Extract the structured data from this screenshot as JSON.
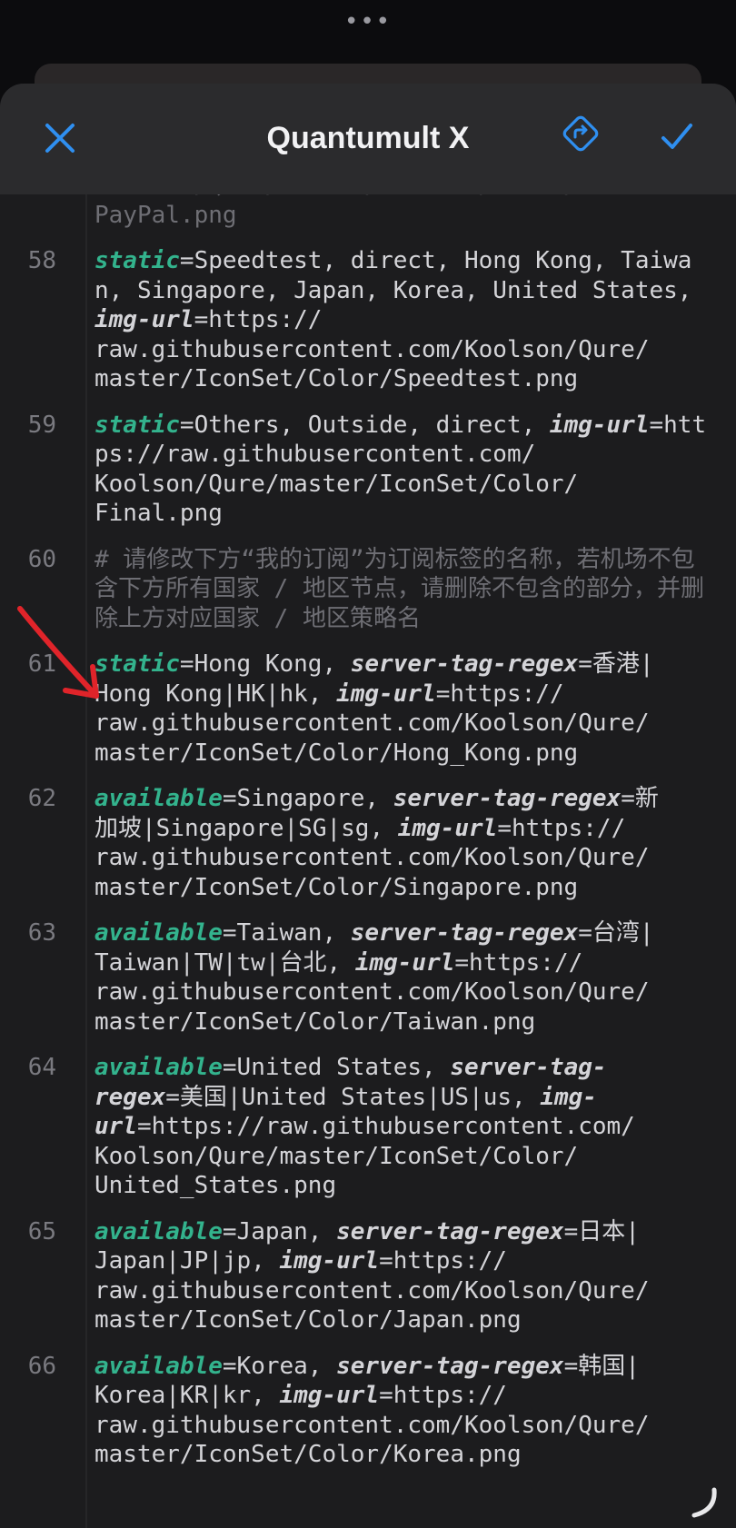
{
  "nav": {
    "title": "Quantumult X"
  },
  "lines": [
    {
      "num": "",
      "parts": [
        {
          "t": "Koolson/Qure/master/IconSet/Color/\nPayPal.png",
          "c": "dim"
        }
      ]
    },
    {
      "num": "58",
      "parts": [
        {
          "t": "static",
          "c": "kw"
        },
        {
          "t": "=Speedtest, direct, Hong Kong, Taiwan, Singapore, Japan, Korea, United States, "
        },
        {
          "t": "img-url",
          "c": "opt"
        },
        {
          "t": "=https://\nraw.githubusercontent.com/Koolson/Qure/\nmaster/IconSet/Color/Speedtest.png"
        }
      ]
    },
    {
      "num": "59",
      "parts": [
        {
          "t": "static",
          "c": "kw"
        },
        {
          "t": "=Others, Outside, direct, "
        },
        {
          "t": "img-url",
          "c": "opt"
        },
        {
          "t": "=https://raw.githubusercontent.com/\nKoolson/Qure/master/IconSet/Color/\nFinal.png"
        }
      ]
    },
    {
      "num": "60",
      "parts": [
        {
          "t": "# 请修改下方“我的订阅”为订阅标签的名称，若机场不包含下方所有国家 / 地区节点，请删除不包含的部分，并删除上方对应国家 / 地区策略名",
          "c": "comment"
        }
      ]
    },
    {
      "num": "61",
      "parts": [
        {
          "t": "static",
          "c": "kw"
        },
        {
          "t": "=Hong Kong, "
        },
        {
          "t": "server-tag-regex",
          "c": "opt"
        },
        {
          "t": "=香港|\nHong Kong|HK|hk, "
        },
        {
          "t": "img-url",
          "c": "opt"
        },
        {
          "t": "=https://\nraw.githubusercontent.com/Koolson/Qure/\nmaster/IconSet/Color/Hong_Kong.png"
        }
      ]
    },
    {
      "num": "62",
      "parts": [
        {
          "t": "available",
          "c": "kw"
        },
        {
          "t": "=Singapore, "
        },
        {
          "t": "server-tag-regex",
          "c": "opt"
        },
        {
          "t": "=新\n加坡|Singapore|SG|sg, "
        },
        {
          "t": "img-url",
          "c": "opt"
        },
        {
          "t": "=https://\nraw.githubusercontent.com/Koolson/Qure/\nmaster/IconSet/Color/Singapore.png"
        }
      ]
    },
    {
      "num": "63",
      "parts": [
        {
          "t": "available",
          "c": "kw"
        },
        {
          "t": "=Taiwan, "
        },
        {
          "t": "server-tag-regex",
          "c": "opt"
        },
        {
          "t": "=台湾|\nTaiwan|TW|tw|台北, "
        },
        {
          "t": "img-url",
          "c": "opt"
        },
        {
          "t": "=https://\nraw.githubusercontent.com/Koolson/Qure/\nmaster/IconSet/Color/Taiwan.png"
        }
      ]
    },
    {
      "num": "64",
      "parts": [
        {
          "t": "available",
          "c": "kw"
        },
        {
          "t": "=United States, "
        },
        {
          "t": "server-tag-\nregex",
          "c": "opt"
        },
        {
          "t": "=美国|United States|US|us, "
        },
        {
          "t": "img-\nurl",
          "c": "opt"
        },
        {
          "t": "=https://raw.githubusercontent.com/\nKoolson/Qure/master/IconSet/Color/\nUnited_States.png"
        }
      ]
    },
    {
      "num": "65",
      "parts": [
        {
          "t": "available",
          "c": "kw"
        },
        {
          "t": "=Japan, "
        },
        {
          "t": "server-tag-regex",
          "c": "opt"
        },
        {
          "t": "=日本|\nJapan|JP|jp, "
        },
        {
          "t": "img-url",
          "c": "opt"
        },
        {
          "t": "=https://\nraw.githubusercontent.com/Koolson/Qure/\nmaster/IconSet/Color/Japan.png"
        }
      ]
    },
    {
      "num": "66",
      "parts": [
        {
          "t": "available",
          "c": "kw"
        },
        {
          "t": "=Korea, "
        },
        {
          "t": "server-tag-regex",
          "c": "opt"
        },
        {
          "t": "=韩国|\nKorea|KR|kr, "
        },
        {
          "t": "img-url",
          "c": "opt"
        },
        {
          "t": "=https://\nraw.githubusercontent.com/Koolson/Qure/\nmaster/IconSet/Color/Korea.png"
        }
      ]
    }
  ],
  "colors": {
    "accent": "#2f8ff0",
    "keyword": "#33b38d",
    "annotation": "#e0242a"
  },
  "icons": {
    "close": "close-icon",
    "share": "share-icon",
    "confirm": "checkmark-icon"
  }
}
